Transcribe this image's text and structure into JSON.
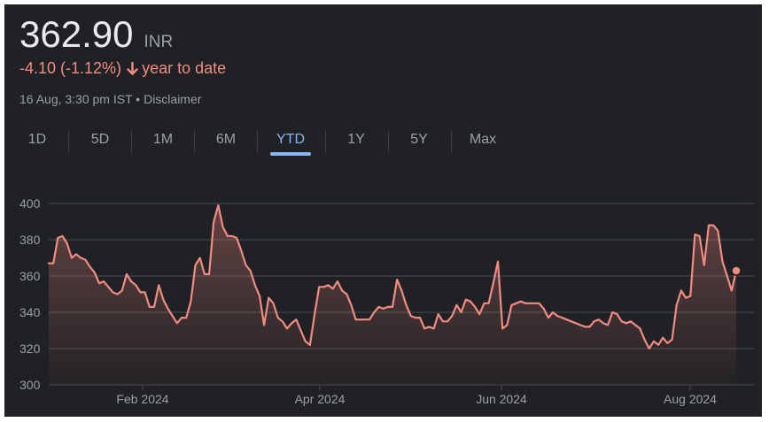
{
  "header": {
    "price": "362.90",
    "currency": "INR",
    "change": "-4.10 (-1.12%)",
    "period_label": "year to date",
    "arrow_icon": "arrow-down-icon",
    "timestamp": "16 Aug, 3:30 pm IST",
    "separator": "•",
    "disclaimer": "Disclaimer"
  },
  "tabs": [
    {
      "label": "1D",
      "active": false
    },
    {
      "label": "5D",
      "active": false
    },
    {
      "label": "1M",
      "active": false
    },
    {
      "label": "6M",
      "active": false
    },
    {
      "label": "YTD",
      "active": true
    },
    {
      "label": "1Y",
      "active": false
    },
    {
      "label": "5Y",
      "active": false
    },
    {
      "label": "Max",
      "active": false
    }
  ],
  "colors": {
    "background": "#202124",
    "line": "#f28b82",
    "negative": "#f28b82",
    "active_tab": "#8ab4f8",
    "muted_text": "#9aa0a6",
    "grid": "#3c4043"
  },
  "chart_data": {
    "type": "area",
    "title": "",
    "xlabel": "",
    "ylabel": "",
    "ylim": [
      300,
      400
    ],
    "yticks": [
      300,
      320,
      340,
      360,
      380,
      400
    ],
    "xticks": [
      "Feb 2024",
      "Apr 2024",
      "Jun 2024",
      "Aug 2024"
    ],
    "grid": true,
    "legend": "none",
    "series": [
      {
        "values": [
          367,
          367,
          381,
          382,
          378,
          370,
          372,
          370,
          369,
          365,
          362,
          356,
          357,
          354,
          351,
          350,
          352,
          361,
          357,
          355,
          351,
          351,
          343,
          343,
          355,
          347,
          342,
          338,
          334,
          337,
          337,
          346,
          366,
          370,
          361,
          361,
          390,
          399,
          387,
          382,
          382,
          381,
          374,
          366,
          363,
          355,
          349,
          333,
          348,
          345,
          337,
          335,
          331,
          334,
          336,
          330,
          324,
          322,
          339,
          354,
          354,
          355,
          353,
          357,
          352,
          350,
          344,
          336,
          336,
          336,
          336,
          340,
          343,
          342,
          343,
          343,
          358,
          352,
          344,
          338,
          337,
          337,
          331,
          332,
          331,
          339,
          335,
          335,
          338,
          344,
          340,
          347,
          346,
          343,
          339,
          345,
          345,
          356,
          368,
          331,
          333,
          344,
          345,
          346,
          345,
          345,
          345,
          345,
          342,
          337,
          340,
          338,
          337,
          336,
          335,
          334,
          333,
          332,
          332,
          335,
          336,
          334,
          333,
          340,
          339,
          335,
          334,
          335,
          333,
          331,
          325,
          320,
          324,
          322,
          326,
          323,
          325,
          344,
          352,
          348,
          349,
          383,
          382,
          366,
          388,
          388,
          385,
          368,
          360,
          352,
          362.9
        ]
      }
    ]
  }
}
